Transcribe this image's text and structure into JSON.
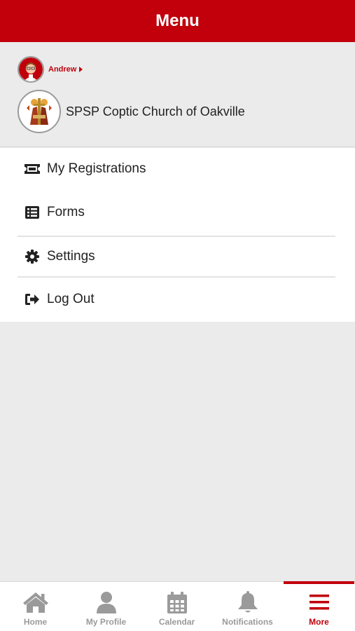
{
  "header": {
    "title": "Menu"
  },
  "user": {
    "name": "Andrew"
  },
  "church": {
    "name": "SPSP Coptic Church of Oakville"
  },
  "menu": {
    "items": [
      {
        "label": "My Registrations",
        "icon": "ticket-icon"
      },
      {
        "label": "Forms",
        "icon": "list-icon"
      },
      {
        "label": "Settings",
        "icon": "gear-icon"
      },
      {
        "label": "Log Out",
        "icon": "sign-out-icon"
      }
    ]
  },
  "tabs": [
    {
      "label": "Home",
      "icon": "home-icon"
    },
    {
      "label": "My Profile",
      "icon": "user-icon"
    },
    {
      "label": "Calendar",
      "icon": "calendar-icon"
    },
    {
      "label": "Notifications",
      "icon": "bell-icon"
    },
    {
      "label": "More",
      "icon": "hamburger-icon",
      "active": true
    }
  ],
  "colors": {
    "brand": "#c1000b",
    "inactive": "#9a9a9a",
    "background": "#ebebeb"
  }
}
